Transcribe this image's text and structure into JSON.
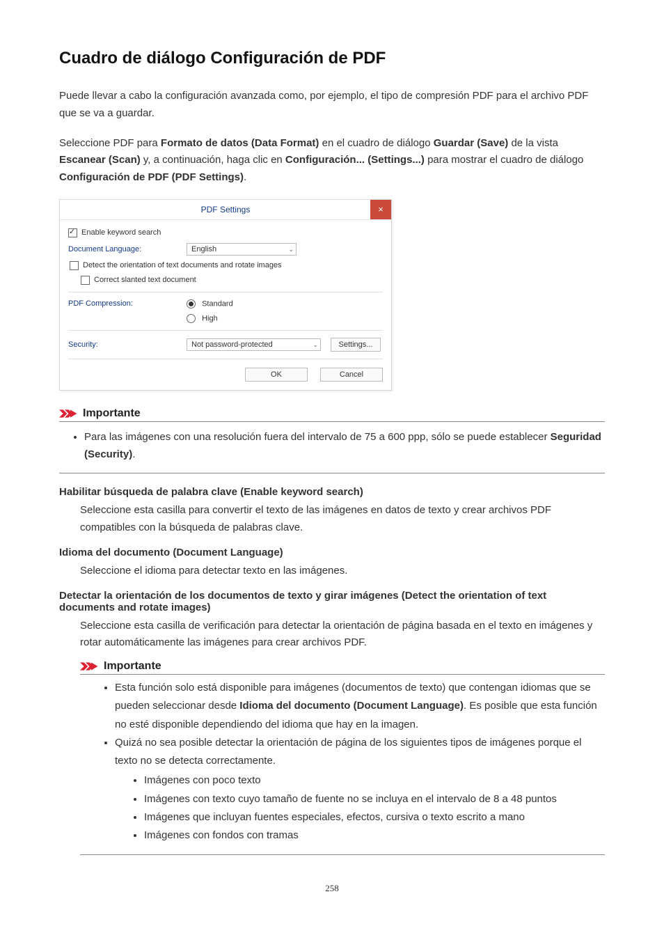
{
  "title": "Cuadro de diálogo Configuración de PDF",
  "intro1": "Puede llevar a cabo la configuración avanzada como, por ejemplo, el tipo de compresión PDF para el archivo PDF que se va a guardar.",
  "intro2a": "Seleccione PDF para ",
  "intro2_b1": "Formato de datos (Data Format)",
  "intro2b": " en el cuadro de diálogo ",
  "intro2_b2": "Guardar (Save)",
  "intro2c": " de la vista ",
  "intro2_b3": "Escanear (Scan)",
  "intro2d": " y, a continuación, haga clic en ",
  "intro2_b4": "Configuración... (Settings...)",
  "intro2e": " para mostrar el cuadro de diálogo ",
  "intro2_b5": "Configuración de PDF (PDF Settings)",
  "intro2f": ".",
  "dlg": {
    "title": "PDF Settings",
    "close": "×",
    "enable_kw": "Enable keyword search",
    "doc_lang_label": "Document Language:",
    "doc_lang_val": "English",
    "detect_orient": "Detect the orientation of text documents and rotate images",
    "correct_slanted": "Correct slanted text document",
    "compression_label": "PDF Compression:",
    "comp_standard": "Standard",
    "comp_high": "High",
    "security_label": "Security:",
    "security_val": "Not password-protected",
    "settings_btn": "Settings...",
    "ok": "OK",
    "cancel": "Cancel"
  },
  "important_label": "Importante",
  "important1_item_a": "Para las imágenes con una resolución fuera del intervalo de 75 a 600 ppp, sólo se puede establecer ",
  "important1_item_bold": "Seguridad (Security)",
  "important1_item_b": ".",
  "defs": {
    "t1": "Habilitar búsqueda de palabra clave (Enable keyword search)",
    "d1": "Seleccione esta casilla para convertir el texto de las imágenes en datos de texto y crear archivos PDF compatibles con la búsqueda de palabras clave.",
    "t2": "Idioma del documento (Document Language)",
    "d2": "Seleccione el idioma para detectar texto en las imágenes.",
    "t3": "Detectar la orientación de los documentos de texto y girar imágenes (Detect the orientation of text documents and rotate images)",
    "d3": "Seleccione esta casilla de verificación para detectar la orientación de página basada en el texto en imágenes y rotar automáticamente las imágenes para crear archivos PDF."
  },
  "important2": {
    "b1a": "Esta función solo está disponible para imágenes (documentos de texto) que contengan idiomas que se pueden seleccionar desde ",
    "b1_bold": "Idioma del documento (Document Language)",
    "b1b": ". Es posible que esta función no esté disponible dependiendo del idioma que hay en la imagen.",
    "b2": "Quizá no sea posible detectar la orientación de página de los siguientes tipos de imágenes porque el texto no se detecta correctamente.",
    "sub1": "Imágenes con poco texto",
    "sub2": "Imágenes con texto cuyo tamaño de fuente no se incluya en el intervalo de 8 a 48 puntos",
    "sub3": "Imágenes que incluyan fuentes especiales, efectos, cursiva o texto escrito a mano",
    "sub4": "Imágenes con fondos con tramas"
  },
  "page_number": "258",
  "chart_data": null
}
